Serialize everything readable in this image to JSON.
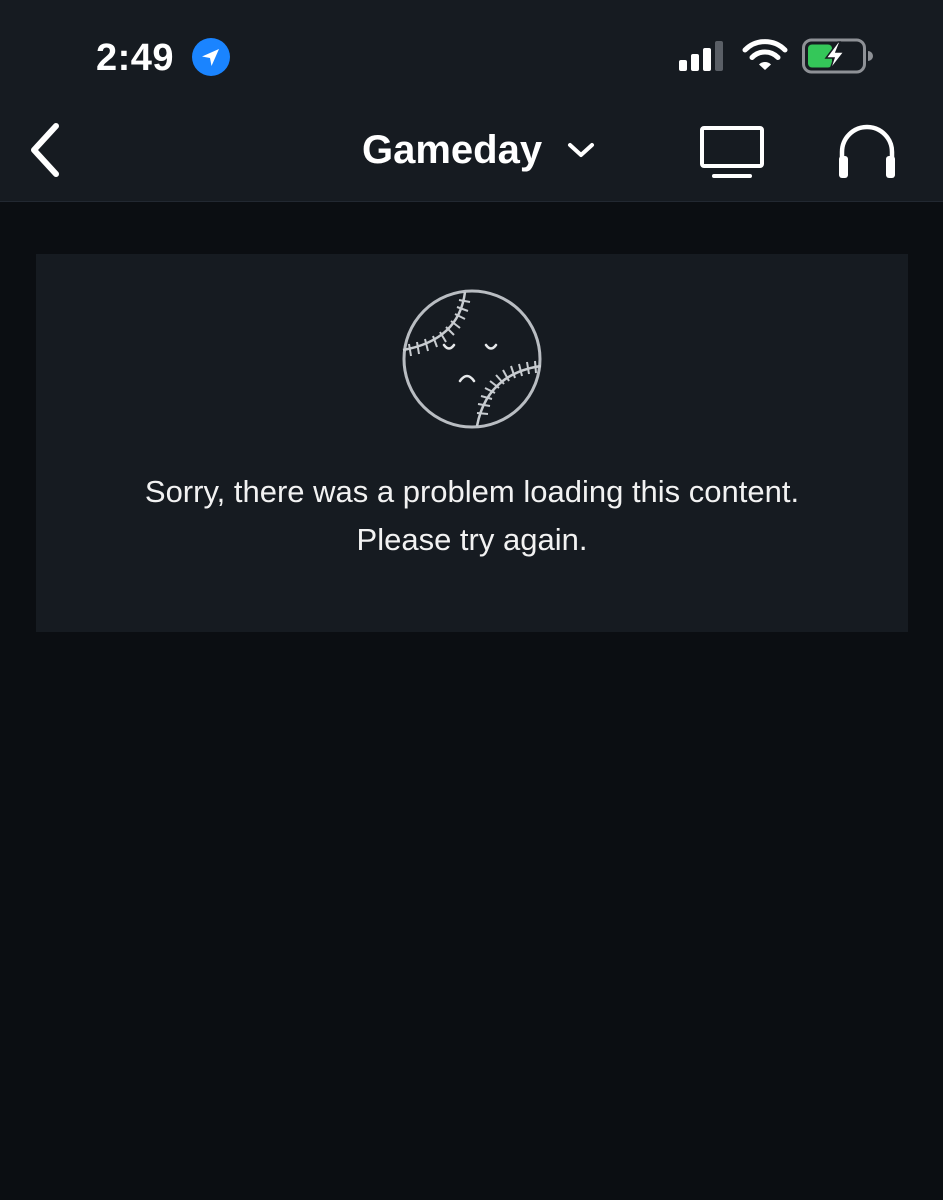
{
  "status_bar": {
    "time": "2:49",
    "location_icon": "location-arrow-icon",
    "signal_icon": "cellular-signal-icon",
    "wifi_icon": "wifi-icon",
    "battery_icon": "battery-charging-icon",
    "location_color": "#1a84ff",
    "battery_color": "#34c759"
  },
  "nav": {
    "back_icon": "chevron-left-icon",
    "title": "Gameday",
    "title_icon": "chevron-down-icon",
    "tv_icon": "tv-icon",
    "audio_icon": "headphones-icon"
  },
  "error": {
    "icon": "sad-baseball-icon",
    "line1": "Sorry, there was a problem loading this content.",
    "line2": "Please try again."
  },
  "colors": {
    "background": "#0b0e12",
    "header": "#161b21",
    "card": "#161b21",
    "text": "#ffffff"
  }
}
